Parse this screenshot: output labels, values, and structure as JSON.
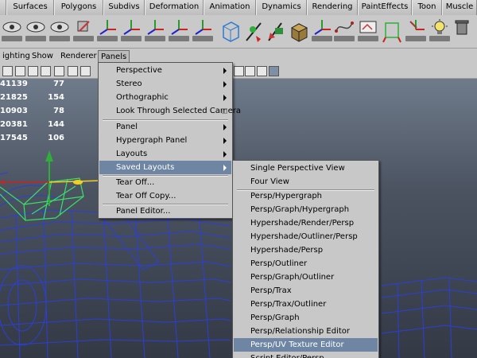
{
  "shelf_tabs": [
    "",
    "Surfaces",
    "Polygons",
    "Subdivs",
    "Deformation",
    "Animation",
    "Dynamics",
    "Rendering",
    "PaintEffects",
    "Toon",
    "Muscle"
  ],
  "panel_menubar": [
    "ighting",
    "Show",
    "Renderer",
    "Panels"
  ],
  "poly_stats": [
    {
      "a": "41139",
      "b": "77"
    },
    {
      "a": "21825",
      "b": "154"
    },
    {
      "a": "10903",
      "b": "78"
    },
    {
      "a": "20381",
      "b": "144"
    },
    {
      "a": "17545",
      "b": "106"
    }
  ],
  "panels_menu": {
    "items": [
      {
        "label": "Perspective",
        "submenu": true
      },
      {
        "label": "Stereo",
        "submenu": true
      },
      {
        "label": "Orthographic",
        "submenu": true
      },
      {
        "label": "Look Through Selected Camera",
        "option_box": true
      },
      {
        "label": "Panel",
        "submenu": true
      },
      {
        "label": "Hypergraph Panel",
        "submenu": true
      },
      {
        "label": "Layouts",
        "submenu": true
      },
      {
        "label": "Saved Layouts",
        "submenu": true,
        "highlighted": true
      },
      {
        "label": "Tear Off..."
      },
      {
        "label": "Tear Off Copy..."
      },
      {
        "label": "Panel Editor..."
      }
    ]
  },
  "saved_layouts_menu": {
    "items": [
      "Single Perspective View",
      "Four View",
      "Persp/Hypergraph",
      "Persp/Graph/Hypergraph",
      "Hypershade/Render/Persp",
      "Hypershade/Outliner/Persp",
      "Hypershade/Persp",
      "Persp/Outliner",
      "Persp/Graph/Outliner",
      "Persp/Trax",
      "Persp/Trax/Outliner",
      "Persp/Graph",
      "Persp/Relationship Editor",
      "Persp/UV Texture Editor",
      "Script Editor/Persp"
    ],
    "highlighted_item": "Persp/UV Texture Editor"
  },
  "colors": {
    "menu_bg": "#c8c8c8",
    "highlight": "#6e86a4",
    "wireframe": "#2c3fd6",
    "selected_wireframe": "#39e06a"
  }
}
